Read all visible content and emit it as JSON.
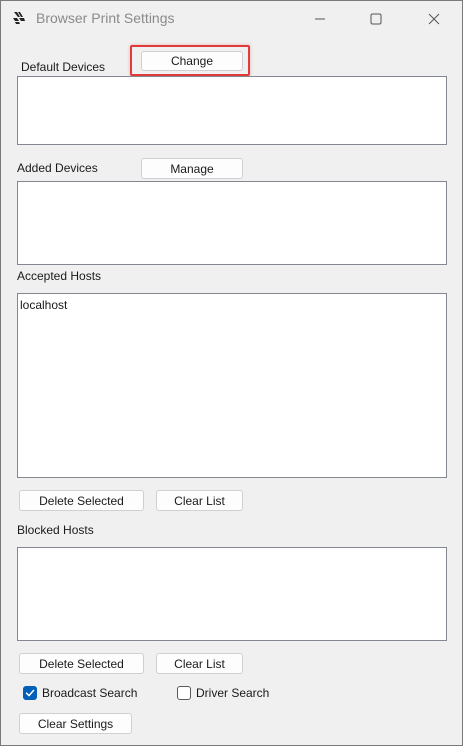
{
  "window": {
    "title": "Browser Print Settings"
  },
  "default_devices": {
    "label": "Default Devices",
    "change_button": "Change",
    "items": []
  },
  "added_devices": {
    "label": "Added Devices",
    "manage_button": "Manage",
    "items": []
  },
  "accepted_hosts": {
    "label": "Accepted Hosts",
    "items": [
      "localhost"
    ],
    "delete_button": "Delete Selected",
    "clear_button": "Clear List"
  },
  "blocked_hosts": {
    "label": "Blocked Hosts",
    "items": [],
    "delete_button": "Delete Selected",
    "clear_button": "Clear List"
  },
  "options": {
    "broadcast_search": {
      "label": "Broadcast Search",
      "checked": true
    },
    "driver_search": {
      "label": "Driver Search",
      "checked": false
    }
  },
  "clear_settings_button": "Clear Settings",
  "colors": {
    "accent": "#005fb8",
    "highlight": "#e03c3c",
    "window_bg": "#f0f0f0"
  }
}
